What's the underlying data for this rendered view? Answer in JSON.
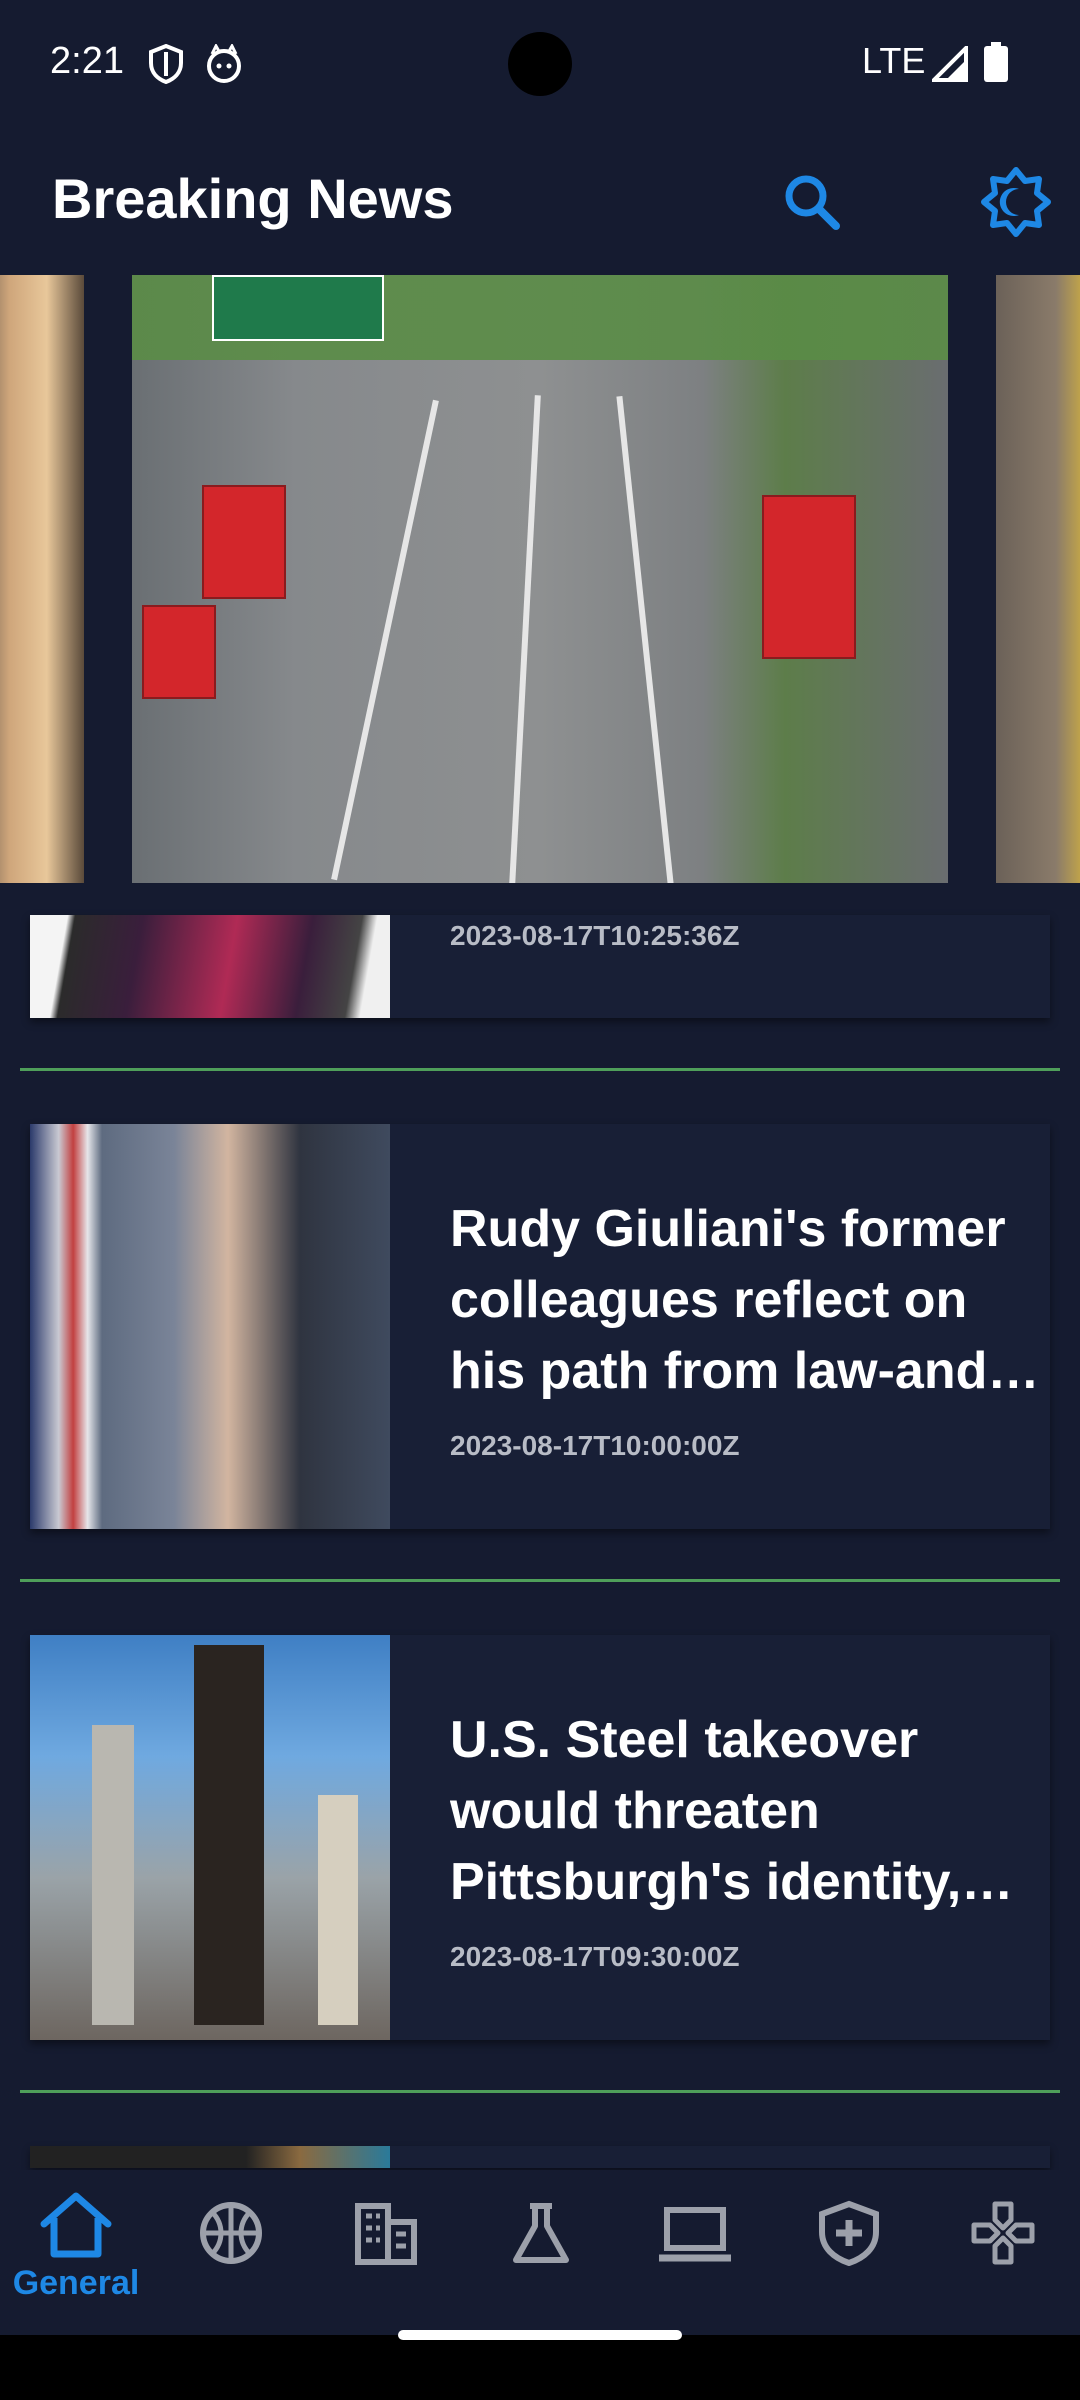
{
  "status_bar": {
    "time": "2:21",
    "network": "LTE"
  },
  "app_bar": {
    "title": "Breaking News"
  },
  "icons": {
    "search": "search-icon",
    "theme": "brightness-icon"
  },
  "articles": [
    {
      "title": "",
      "date": "2023-08-17T10:25:36Z"
    },
    {
      "title": "Rudy Giuliani's former colleagues reflect on his path from law-and-order hero",
      "date": "2023-08-17T10:00:00Z"
    },
    {
      "title": "U.S. Steel takeover would threaten Pittsburgh's identity, workers say",
      "date": "2023-08-17T09:30:00Z"
    }
  ],
  "bottom_nav": {
    "selected": "General",
    "items": [
      {
        "label": "General",
        "icon": "home-icon"
      },
      {
        "label": "",
        "icon": "basketball-icon"
      },
      {
        "label": "",
        "icon": "business-icon"
      },
      {
        "label": "",
        "icon": "science-icon"
      },
      {
        "label": "",
        "icon": "laptop-icon"
      },
      {
        "label": "",
        "icon": "health-icon"
      },
      {
        "label": "",
        "icon": "gamepad-icon"
      }
    ]
  },
  "colors": {
    "background": "#151b30",
    "accent": "#1e88e5",
    "divider": "#4f9f5a",
    "date_text": "#b8bcc6"
  }
}
